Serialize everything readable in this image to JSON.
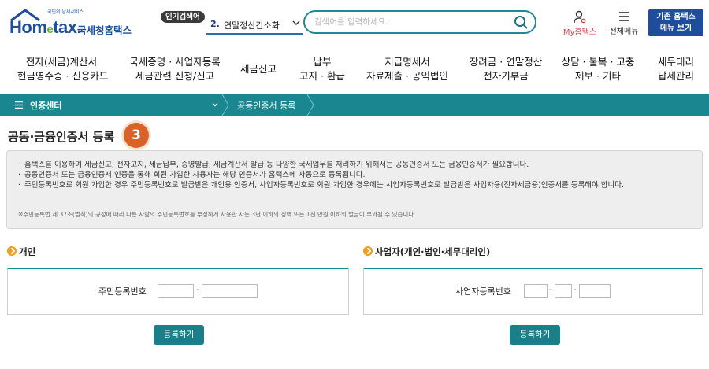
{
  "header": {
    "logo_small": "국민의 납세서비스",
    "logo_brand_a": "Hom",
    "logo_brand_e": "e",
    "logo_brand_b": "tax.",
    "logo_agency": "국세청홈택스",
    "popular_tag": "인기검색어",
    "popular_rank": "2.",
    "popular_keyword": "연말정산간소화",
    "search_placeholder": "검색어를 입력하세요.",
    "mytax_label": "My홈택스",
    "allmenu_label": "전체메뉴",
    "oldmenu_line1": "기존 홈택스",
    "oldmenu_line2": "메뉴 보기"
  },
  "gnb": [
    {
      "line1": "전자(세금)계산서",
      "line2": "현금영수증 · 신용카드"
    },
    {
      "line1": "국세증명 · 사업자등록",
      "line2": "세금관련 신청/신고"
    },
    {
      "line1": "세금신고",
      "line2": ""
    },
    {
      "line1": "납부",
      "line2": "고지 · 환급"
    },
    {
      "line1": "지급명세서",
      "line2": "자료제출 · 공익법인"
    },
    {
      "line1": "장려금 · 연말정산",
      "line2": "전자기부금"
    },
    {
      "line1": "상담 · 불복 · 고충",
      "line2": "제보 · 기타"
    },
    {
      "line1": "세무대리",
      "line2": "납세관리"
    }
  ],
  "breadcrumb": {
    "level1": "인증센터",
    "level2": "공동인증서 등록"
  },
  "page": {
    "title": "공동·금융인증서 등록",
    "step_badge": "3"
  },
  "notice": {
    "items": [
      "홈택스를 이용하여 세금신고, 전자고지, 세금납부, 증명발급, 세금계산서 발급 등 다양한 국세업무를 처리하기 위해서는 공동인증서 또는 금융인증서가 필요합니다.",
      "공동인증서 또는 금융인증서 인증을 통해 회원 가입한 사용자는 해당 인증서가 홈택스에 자동으로 등록됩니다.",
      "주민등록번호로 회원 가입한 경우 주민등록번호로 발급받은 개인용 인증서, 사업자등록번호로 회원 가입한 경우에는 사업자등록번호로 발급받은 사업자용(전자세금용)인증서를 등록해야 합니다."
    ],
    "footnote": "※주민등록법 제 37조(벌칙)의 규정에 따라 다른 사람의 주민등록번호를 부정하게 사용한 자는 3년 이하의 징역 또는 1천 만원 이하의 벌금이 부과될 수 있습니다."
  },
  "individual": {
    "section_title": "개인",
    "field_label": "주민등록번호",
    "dash": "-",
    "button_label": "등록하기"
  },
  "business": {
    "section_title": "사업자(개인·법인·세무대리인)",
    "field_label": "사업자등록번호",
    "dash": "-",
    "button_label": "등록하기"
  },
  "colors": {
    "brand_blue": "#1f4f9c",
    "brand_green": "#6bb32e",
    "teal": "#1a8790",
    "step_orange": "#d9622b",
    "section_dot": "#e8a21c",
    "mytax_red": "#e8414e"
  }
}
